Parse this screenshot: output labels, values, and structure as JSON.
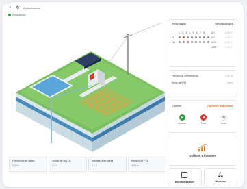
{
  "topbar": {
    "back_icon": "arrow-left-icon",
    "refresh_icon": "refresh-icon",
    "title": "Monitorización"
  },
  "status": {
    "label": "En marcha",
    "color": "#2e9e3e"
  },
  "signals": {
    "tab_digital": "Señal digital",
    "tab_analog": "Señal analógica",
    "channels": [
      "1",
      "2",
      "3",
      "4",
      "5",
      "6",
      "7",
      "8"
    ],
    "rows": [
      {
        "label": "",
        "analog_name": "AI1",
        "analog_value": "0,00 V"
      },
      {
        "label": "DI",
        "analog_name": "AI2",
        "analog_value": "0,00 V"
      },
      {
        "label": "DO",
        "analog_name": "AO1",
        "analog_value": "0,00 V"
      },
      {
        "label": "",
        "analog_name": "AO2",
        "analog_value": "0,00 V"
      }
    ]
  },
  "info": {
    "ref_freq_label": "Frecuencia de referencia",
    "ref_freq_value": "0,00 Hz",
    "pid_mode_label": "Modo del PID",
    "pid_mode_value": "Activo"
  },
  "control": {
    "title": "Control",
    "options_label": "Opciones avanzadas",
    "buttons": [
      {
        "label": "Arrancar",
        "icon": "play-icon",
        "color": "#2e9e3e"
      },
      {
        "label": "Parar",
        "icon": "stop-icon",
        "color": "#d9342b"
      },
      {
        "label": "Reset",
        "icon": "reset-icon",
        "color": "#e9ebee"
      }
    ]
  },
  "cards": {
    "charts_label": "Gráficos e informes",
    "monitoring_label": "Monitorización",
    "alarms_label": "Alarmas"
  },
  "metrics": [
    {
      "label": "Frecuencia de salida",
      "value": "0,0 Hz"
    },
    {
      "label": "Voltaje de bus DC",
      "value": "0,0 V"
    },
    {
      "label": "Intensidad de salida",
      "value": "0,0 A"
    },
    {
      "label": "Retorno de PID",
      "value": "0,0 bar"
    }
  ]
}
